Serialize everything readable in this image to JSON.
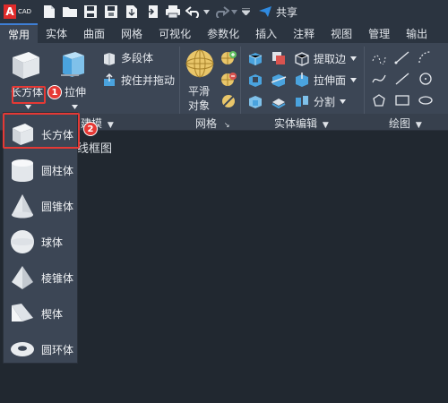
{
  "app": {
    "logo_letter": "A",
    "logo_text": "CAD"
  },
  "quick_access": {
    "share_label": "共享"
  },
  "tabs": [
    "常用",
    "实体",
    "曲面",
    "网格",
    "可视化",
    "参数化",
    "插入",
    "注释",
    "视图",
    "管理",
    "输出"
  ],
  "ribbon": {
    "box_label": "长方体",
    "extrude_label": "拉伸",
    "polysolid_label": "多段体",
    "presspull_label": "按住并拖动",
    "smooth_label_1": "平滑",
    "smooth_label_2": "对象",
    "extract_edges_label": "提取边",
    "extrude_faces_label": "拉伸面",
    "split_label": "分割",
    "panel_model": "建模",
    "panel_mesh": "网格",
    "panel_solid_edit": "实体编辑",
    "panel_draw": "绘图"
  },
  "dropdown": {
    "items": [
      "长方体",
      "圆柱体",
      "圆锥体",
      "球体",
      "棱锥体",
      "楔体",
      "圆环体"
    ]
  },
  "badges": [
    "1",
    "2"
  ],
  "canvas": {
    "partial_label": "线框图"
  },
  "colors": {
    "accent": "#3e7fd6",
    "highlight": "#e53935",
    "background": "#212830",
    "ribbon": "#3c4655"
  }
}
